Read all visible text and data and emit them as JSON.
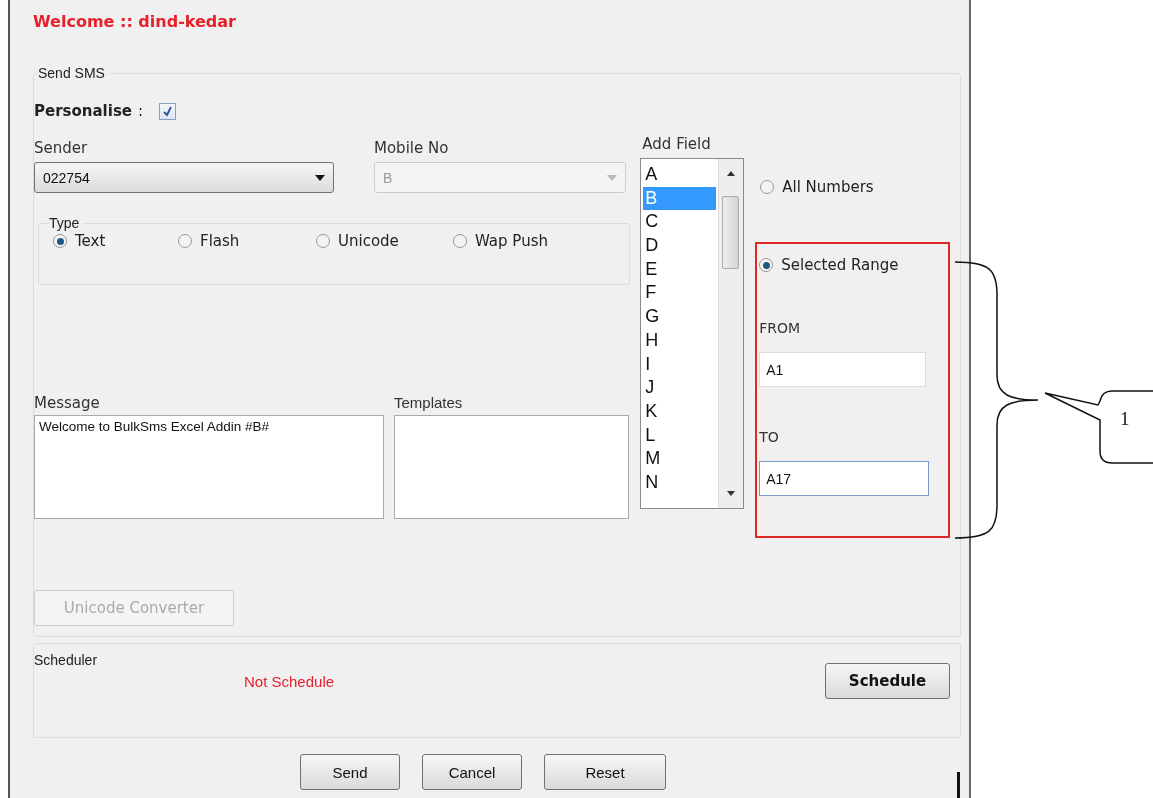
{
  "title": "Welcome :: dind-kedar",
  "send_sms": {
    "label": "Send SMS",
    "personalise": {
      "label": "Personalise",
      "separator": ":",
      "checked": true
    },
    "sender": {
      "label": "Sender",
      "value": "022754",
      "disabled": false
    },
    "mobile_no": {
      "label": "Mobile No",
      "value": "B",
      "disabled": true
    },
    "type": {
      "label": "Type",
      "options": [
        {
          "label": "Text",
          "selected": true
        },
        {
          "label": "Flash",
          "selected": false
        },
        {
          "label": "Unicode",
          "selected": false
        },
        {
          "label": "Wap Push",
          "selected": false
        }
      ]
    },
    "add_field": {
      "label": "Add Field",
      "items": [
        {
          "label": "A",
          "selected": false
        },
        {
          "label": "B",
          "selected": true
        },
        {
          "label": "C",
          "selected": false
        },
        {
          "label": "D",
          "selected": false
        },
        {
          "label": "E",
          "selected": false
        },
        {
          "label": "F",
          "selected": false
        },
        {
          "label": "G",
          "selected": false
        },
        {
          "label": "H",
          "selected": false
        },
        {
          "label": "I",
          "selected": false
        },
        {
          "label": "J",
          "selected": false
        },
        {
          "label": "K",
          "selected": false
        },
        {
          "label": "L",
          "selected": false
        },
        {
          "label": "M",
          "selected": false
        },
        {
          "label": "N",
          "selected": false
        }
      ]
    },
    "range": {
      "all_numbers": {
        "label": "All Numbers",
        "selected": false
      },
      "selected_range": {
        "label": "Selected Range",
        "selected": true
      },
      "from": {
        "label": "FROM",
        "value": "A1"
      },
      "to": {
        "label": "TO",
        "value": "A17"
      }
    },
    "message": {
      "label": "Message",
      "value": "Welcome to BulkSms Excel Addin #B#"
    },
    "templates": {
      "label": "Templates"
    },
    "unicode_converter": {
      "label": "Unicode Converter",
      "disabled": true
    }
  },
  "scheduler": {
    "label": "Scheduler",
    "status": "Not Schedule",
    "button": "Schedule"
  },
  "buttons": [
    "Send",
    "Cancel",
    "Reset"
  ],
  "annotation": {
    "label": "1"
  }
}
